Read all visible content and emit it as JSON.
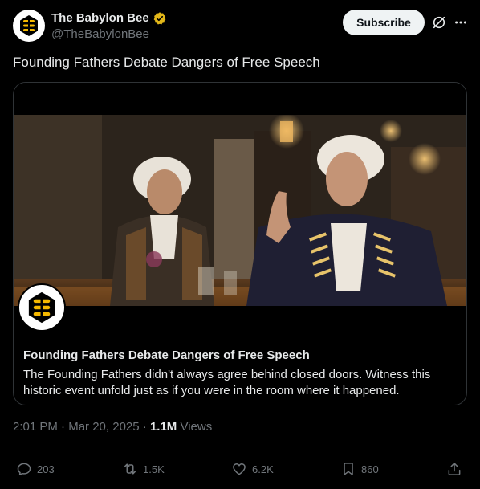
{
  "account": {
    "display_name": "The Babylon Bee",
    "handle": "@TheBabylonBee",
    "verified_color": "#e2b719"
  },
  "header": {
    "subscribe_label": "Subscribe"
  },
  "tweet": {
    "text": "Founding Fathers Debate Dangers of Free Speech"
  },
  "card": {
    "title": "Founding Fathers Debate Dangers of Free Speech",
    "description": "The Founding Fathers didn't always agree behind closed doors. Witness this historic event unfold just as if you were in the room where it happened."
  },
  "meta": {
    "time": "2:01 PM",
    "date": "Mar 20, 2025",
    "views_count": "1.1M",
    "views_label": "Views"
  },
  "actions": {
    "replies": "203",
    "reposts": "1.5K",
    "likes": "6.2K",
    "bookmarks": "860"
  },
  "icons": {
    "verified": "verified-badge-icon",
    "grok": "grok-icon",
    "more": "more-icon",
    "reply": "reply-icon",
    "repost": "repost-icon",
    "like": "heart-icon",
    "bookmark": "bookmark-icon",
    "share": "share-icon"
  },
  "colors": {
    "background": "#000000",
    "text": "#e7e9ea",
    "secondary": "#71767b",
    "border": "#2f3336",
    "subscribe_bg": "#eff3f4"
  }
}
